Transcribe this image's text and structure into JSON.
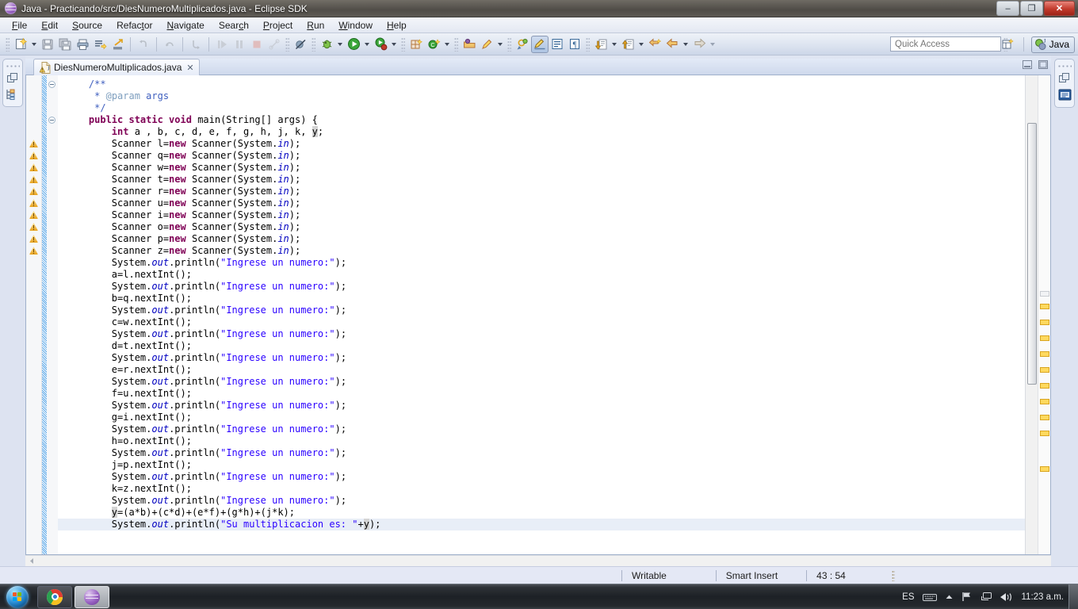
{
  "window": {
    "title": "Java - Practicando/src/DiesNumeroMultiplicados.java - Eclipse SDK",
    "app_icon": "eclipse-icon",
    "minimize_label": "–",
    "restore_label": "❐",
    "close_label": "✕"
  },
  "menu": {
    "items": [
      {
        "label": "File",
        "mnemonic": "F"
      },
      {
        "label": "Edit",
        "mnemonic": "E"
      },
      {
        "label": "Source",
        "mnemonic": "S"
      },
      {
        "label": "Refactor",
        "mnemonic": "t"
      },
      {
        "label": "Navigate",
        "mnemonic": "N"
      },
      {
        "label": "Search",
        "mnemonic": "c"
      },
      {
        "label": "Project",
        "mnemonic": "P"
      },
      {
        "label": "Run",
        "mnemonic": "R"
      },
      {
        "label": "Window",
        "mnemonic": "W"
      },
      {
        "label": "Help",
        "mnemonic": "H"
      }
    ]
  },
  "toolbar": {
    "buttons": [
      {
        "name": "new-wizard-icon",
        "title": "New"
      },
      {
        "name": "new-wizard-dropdown-icon",
        "title": "New dropdown"
      },
      {
        "name": "save-icon",
        "title": "Save"
      },
      {
        "name": "save-all-icon",
        "title": "Save All"
      },
      {
        "name": "print-icon",
        "title": "Print"
      },
      {
        "name": "build-all-icon",
        "title": "Build All"
      },
      {
        "name": "export-icon",
        "title": "Export"
      },
      {
        "name": "undo-icon",
        "title": "Undo"
      },
      {
        "name": "redo-icon",
        "title": "Redo"
      },
      {
        "name": "step-return-icon",
        "title": "Step Return"
      },
      {
        "name": "resume-icon",
        "title": "Resume"
      },
      {
        "name": "suspend-icon",
        "title": "Suspend"
      },
      {
        "name": "terminate-icon",
        "title": "Terminate"
      },
      {
        "name": "disconnect-icon",
        "title": "Disconnect"
      },
      {
        "name": "skip-breakpoints-icon",
        "title": "Skip All Breakpoints"
      },
      {
        "name": "debug-icon",
        "title": "Debug"
      },
      {
        "name": "debug-dropdown-icon",
        "title": "Debug dropdown"
      },
      {
        "name": "run-icon",
        "title": "Run"
      },
      {
        "name": "run-dropdown-icon",
        "title": "Run dropdown"
      },
      {
        "name": "coverage-icon",
        "title": "Coverage"
      },
      {
        "name": "coverage-dropdown-icon",
        "title": "Coverage dropdown"
      },
      {
        "name": "new-java-package-icon",
        "title": "New Java Package"
      },
      {
        "name": "new-java-class-icon",
        "title": "New Java Class"
      },
      {
        "name": "new-class-dropdown-icon",
        "title": "New Class dropdown"
      },
      {
        "name": "open-type-icon",
        "title": "Open Type"
      },
      {
        "name": "quick-fix-icon",
        "title": "Quick Fix"
      },
      {
        "name": "quick-fix-dropdown-icon",
        "title": "Quick Fix dropdown"
      },
      {
        "name": "search-type-icon",
        "title": "Search"
      },
      {
        "name": "toggle-mark-occurrences-icon",
        "title": "Toggle Mark Occurrences",
        "pressed": true
      },
      {
        "name": "show-whitespace-icon",
        "title": "Show Whitespace Characters"
      },
      {
        "name": "pilcrow-icon",
        "title": "Show Print Margin"
      },
      {
        "name": "next-annotation-icon",
        "title": "Next Annotation"
      },
      {
        "name": "next-annotation-dropdown-icon",
        "title": "Next Annotation dropdown"
      },
      {
        "name": "previous-annotation-icon",
        "title": "Previous Annotation"
      },
      {
        "name": "previous-annotation-dropdown-icon",
        "title": "Previous Annotation dropdown"
      },
      {
        "name": "last-edit-location-icon",
        "title": "Last Edit Location"
      },
      {
        "name": "back-icon",
        "title": "Back"
      },
      {
        "name": "back-dropdown-icon",
        "title": "Back dropdown"
      },
      {
        "name": "forward-icon",
        "title": "Forward"
      },
      {
        "name": "forward-dropdown-icon",
        "title": "Forward dropdown"
      }
    ],
    "quick_access_placeholder": "Quick Access",
    "open_perspective_icon": "open-perspective-icon",
    "perspective_label": "Java",
    "perspective_icon": "java-perspective-icon"
  },
  "left_fastbar": {
    "restore_icon": "restore-view-icon",
    "package_explorer_icon": "package-explorer-icon"
  },
  "right_fastbar": {
    "restore_icon": "restore-view-icon",
    "outline_icon": "outline-view-icon"
  },
  "editor": {
    "tab": {
      "label": "DiesNumeroMultiplicados.java",
      "icon": "java-file-warning-icon",
      "close_label": "✕"
    },
    "minimize_icon": "minimize-editor-icon",
    "maximize_icon": "maximize-editor-icon",
    "cursor_offset_chars": 30,
    "current_line_index": 45,
    "code_lines": [
      {
        "indent": 1,
        "tokens": [
          {
            "t": "/**",
            "c": "c"
          }
        ]
      },
      {
        "indent": 1,
        "tokens": [
          {
            "t": " * ",
            "c": "c"
          },
          {
            "t": "@param",
            "c": "ct"
          },
          {
            "t": " args",
            "c": "c"
          }
        ]
      },
      {
        "indent": 1,
        "tokens": [
          {
            "t": " */",
            "c": "c"
          }
        ]
      },
      {
        "indent": 1,
        "tokens": [
          {
            "t": "public static void ",
            "c": "k"
          },
          {
            "t": "main(String[] args) {",
            "c": ""
          }
        ]
      },
      {
        "indent": 2,
        "tokens": [
          {
            "t": "int ",
            "c": "k"
          },
          {
            "t": "a , b, c, d, e, f, g, h, j, k, ",
            "c": ""
          },
          {
            "t": "y",
            "c": "occ"
          },
          {
            "t": ";",
            "c": ""
          }
        ]
      },
      {
        "indent": 2,
        "tokens": [
          {
            "t": "Scanner l=",
            "c": ""
          },
          {
            "t": "new",
            "c": "k"
          },
          {
            "t": " Scanner(System.",
            "c": ""
          },
          {
            "t": "in",
            "c": "f"
          },
          {
            "t": ");",
            "c": ""
          }
        ]
      },
      {
        "indent": 2,
        "tokens": [
          {
            "t": "Scanner q=",
            "c": ""
          },
          {
            "t": "new",
            "c": "k"
          },
          {
            "t": " Scanner(System.",
            "c": ""
          },
          {
            "t": "in",
            "c": "f"
          },
          {
            "t": ");",
            "c": ""
          }
        ]
      },
      {
        "indent": 2,
        "tokens": [
          {
            "t": "Scanner w=",
            "c": ""
          },
          {
            "t": "new",
            "c": "k"
          },
          {
            "t": " Scanner(System.",
            "c": ""
          },
          {
            "t": "in",
            "c": "f"
          },
          {
            "t": ");",
            "c": ""
          }
        ]
      },
      {
        "indent": 2,
        "tokens": [
          {
            "t": "Scanner t=",
            "c": ""
          },
          {
            "t": "new",
            "c": "k"
          },
          {
            "t": " Scanner(System.",
            "c": ""
          },
          {
            "t": "in",
            "c": "f"
          },
          {
            "t": ");",
            "c": ""
          }
        ]
      },
      {
        "indent": 2,
        "tokens": [
          {
            "t": "Scanner r=",
            "c": ""
          },
          {
            "t": "new",
            "c": "k"
          },
          {
            "t": " Scanner(System.",
            "c": ""
          },
          {
            "t": "in",
            "c": "f"
          },
          {
            "t": ");",
            "c": ""
          }
        ]
      },
      {
        "indent": 2,
        "tokens": [
          {
            "t": "Scanner u=",
            "c": ""
          },
          {
            "t": "new",
            "c": "k"
          },
          {
            "t": " Scanner(System.",
            "c": ""
          },
          {
            "t": "in",
            "c": "f"
          },
          {
            "t": ");",
            "c": ""
          }
        ]
      },
      {
        "indent": 2,
        "tokens": [
          {
            "t": "Scanner i=",
            "c": ""
          },
          {
            "t": "new",
            "c": "k"
          },
          {
            "t": " Scanner(System.",
            "c": ""
          },
          {
            "t": "in",
            "c": "f"
          },
          {
            "t": ");",
            "c": ""
          }
        ]
      },
      {
        "indent": 2,
        "tokens": [
          {
            "t": "Scanner o=",
            "c": ""
          },
          {
            "t": "new",
            "c": "k"
          },
          {
            "t": " Scanner(System.",
            "c": ""
          },
          {
            "t": "in",
            "c": "f"
          },
          {
            "t": ");",
            "c": ""
          }
        ]
      },
      {
        "indent": 2,
        "tokens": [
          {
            "t": "Scanner p=",
            "c": ""
          },
          {
            "t": "new",
            "c": "k"
          },
          {
            "t": " Scanner(System.",
            "c": ""
          },
          {
            "t": "in",
            "c": "f"
          },
          {
            "t": ");",
            "c": ""
          }
        ]
      },
      {
        "indent": 2,
        "tokens": [
          {
            "t": "Scanner z=",
            "c": ""
          },
          {
            "t": "new",
            "c": "k"
          },
          {
            "t": " Scanner(System.",
            "c": ""
          },
          {
            "t": "in",
            "c": "f"
          },
          {
            "t": ");",
            "c": ""
          }
        ]
      },
      {
        "indent": 2,
        "tokens": [
          {
            "t": "System.",
            "c": ""
          },
          {
            "t": "out",
            "c": "f"
          },
          {
            "t": ".println(",
            "c": ""
          },
          {
            "t": "\"Ingrese un numero:\"",
            "c": "s"
          },
          {
            "t": ");",
            "c": ""
          }
        ]
      },
      {
        "indent": 2,
        "tokens": [
          {
            "t": "a=l.nextInt();",
            "c": ""
          }
        ]
      },
      {
        "indent": 2,
        "tokens": [
          {
            "t": "System.",
            "c": ""
          },
          {
            "t": "out",
            "c": "f"
          },
          {
            "t": ".println(",
            "c": ""
          },
          {
            "t": "\"Ingrese un numero:\"",
            "c": "s"
          },
          {
            "t": ");",
            "c": ""
          }
        ]
      },
      {
        "indent": 2,
        "tokens": [
          {
            "t": "b=q.nextInt();",
            "c": ""
          }
        ]
      },
      {
        "indent": 2,
        "tokens": [
          {
            "t": "System.",
            "c": ""
          },
          {
            "t": "out",
            "c": "f"
          },
          {
            "t": ".println(",
            "c": ""
          },
          {
            "t": "\"Ingrese un numero:\"",
            "c": "s"
          },
          {
            "t": ");",
            "c": ""
          }
        ]
      },
      {
        "indent": 2,
        "tokens": [
          {
            "t": "c=w.nextInt();",
            "c": ""
          }
        ]
      },
      {
        "indent": 2,
        "tokens": [
          {
            "t": "System.",
            "c": ""
          },
          {
            "t": "out",
            "c": "f"
          },
          {
            "t": ".println(",
            "c": ""
          },
          {
            "t": "\"Ingrese un numero:\"",
            "c": "s"
          },
          {
            "t": ");",
            "c": ""
          }
        ]
      },
      {
        "indent": 2,
        "tokens": [
          {
            "t": "d=t.nextInt();",
            "c": ""
          }
        ]
      },
      {
        "indent": 2,
        "tokens": [
          {
            "t": "System.",
            "c": ""
          },
          {
            "t": "out",
            "c": "f"
          },
          {
            "t": ".println(",
            "c": ""
          },
          {
            "t": "\"Ingrese un numero:\"",
            "c": "s"
          },
          {
            "t": ");",
            "c": ""
          }
        ]
      },
      {
        "indent": 2,
        "tokens": [
          {
            "t": "e=r.nextInt();",
            "c": ""
          }
        ]
      },
      {
        "indent": 2,
        "tokens": [
          {
            "t": "System.",
            "c": ""
          },
          {
            "t": "out",
            "c": "f"
          },
          {
            "t": ".println(",
            "c": ""
          },
          {
            "t": "\"Ingrese un numero:\"",
            "c": "s"
          },
          {
            "t": ");",
            "c": ""
          }
        ]
      },
      {
        "indent": 2,
        "tokens": [
          {
            "t": "f=u.nextInt();",
            "c": ""
          }
        ]
      },
      {
        "indent": 2,
        "tokens": [
          {
            "t": "System.",
            "c": ""
          },
          {
            "t": "out",
            "c": "f"
          },
          {
            "t": ".println(",
            "c": ""
          },
          {
            "t": "\"Ingrese un numero:\"",
            "c": "s"
          },
          {
            "t": ");",
            "c": ""
          }
        ]
      },
      {
        "indent": 2,
        "tokens": [
          {
            "t": "g=i.nextInt();",
            "c": ""
          }
        ]
      },
      {
        "indent": 2,
        "tokens": [
          {
            "t": "System.",
            "c": ""
          },
          {
            "t": "out",
            "c": "f"
          },
          {
            "t": ".println(",
            "c": ""
          },
          {
            "t": "\"Ingrese un numero:\"",
            "c": "s"
          },
          {
            "t": ");",
            "c": ""
          }
        ]
      },
      {
        "indent": 2,
        "tokens": [
          {
            "t": "h=o.nextInt();",
            "c": ""
          }
        ]
      },
      {
        "indent": 2,
        "tokens": [
          {
            "t": "System.",
            "c": ""
          },
          {
            "t": "out",
            "c": "f"
          },
          {
            "t": ".println(",
            "c": ""
          },
          {
            "t": "\"Ingrese un numero:\"",
            "c": "s"
          },
          {
            "t": ");",
            "c": ""
          }
        ]
      },
      {
        "indent": 2,
        "tokens": [
          {
            "t": "j=p.nextInt();",
            "c": ""
          }
        ]
      },
      {
        "indent": 2,
        "tokens": [
          {
            "t": "System.",
            "c": ""
          },
          {
            "t": "out",
            "c": "f"
          },
          {
            "t": ".println(",
            "c": ""
          },
          {
            "t": "\"Ingrese un numero:\"",
            "c": "s"
          },
          {
            "t": ");",
            "c": ""
          }
        ]
      },
      {
        "indent": 2,
        "tokens": [
          {
            "t": "k=z.nextInt();",
            "c": ""
          }
        ]
      },
      {
        "indent": 2,
        "tokens": [
          {
            "t": "System.",
            "c": ""
          },
          {
            "t": "out",
            "c": "f"
          },
          {
            "t": ".println(",
            "c": ""
          },
          {
            "t": "\"Ingrese un numero:\"",
            "c": "s"
          },
          {
            "t": ");",
            "c": ""
          }
        ]
      },
      {
        "indent": 2,
        "tokens": [
          {
            "t": "y",
            "c": "occ"
          },
          {
            "t": "=(a*b)+(c*d)+(e*f)+(g*h)+(j*k);",
            "c": ""
          }
        ]
      },
      {
        "indent": 2,
        "tokens": [
          {
            "t": "System.",
            "c": ""
          },
          {
            "t": "out",
            "c": "f"
          },
          {
            "t": ".println(",
            "c": ""
          },
          {
            "t": "\"Su multiplicacion es: \"",
            "c": "s"
          },
          {
            "t": "+",
            "c": ""
          },
          {
            "t": "y",
            "c": "occ"
          },
          {
            "t": ");",
            "c": ""
          }
        ]
      }
    ],
    "warning_line_indices": [
      5,
      6,
      7,
      8,
      9,
      10,
      11,
      12,
      13,
      14
    ],
    "fold_line_indices": [
      0,
      3
    ],
    "overview_marker_count": 11
  },
  "statusbar": {
    "writable": "Writable",
    "insert_mode": "Smart Insert",
    "cursor_position": "43 : 54"
  },
  "taskbar": {
    "start_icon": "windows-start-icon",
    "buttons": [
      {
        "name": "taskbar-chrome-button",
        "icon": "chrome-icon",
        "active": false
      },
      {
        "name": "taskbar-eclipse-button",
        "icon": "eclipse-icon",
        "active": true
      }
    ],
    "tray": {
      "language": "ES",
      "keyboard_icon": "keyboard-icon",
      "show_hidden_icon": "show-hidden-icons-arrow",
      "action_center_icon": "flag-icon",
      "network_icon": "network-icon",
      "volume_icon": "volume-icon",
      "clock": "11:23 a.m."
    },
    "show_desktop": "show-desktop-button"
  },
  "colors": {
    "keyword": "#7f0055",
    "string": "#2a00ff",
    "comment": "#3f5fbf",
    "javadoc_tag": "#7f9fbf",
    "static_field": "#0000c0",
    "warning_marker": "#ffd95e",
    "current_line": "#e8eef7"
  }
}
